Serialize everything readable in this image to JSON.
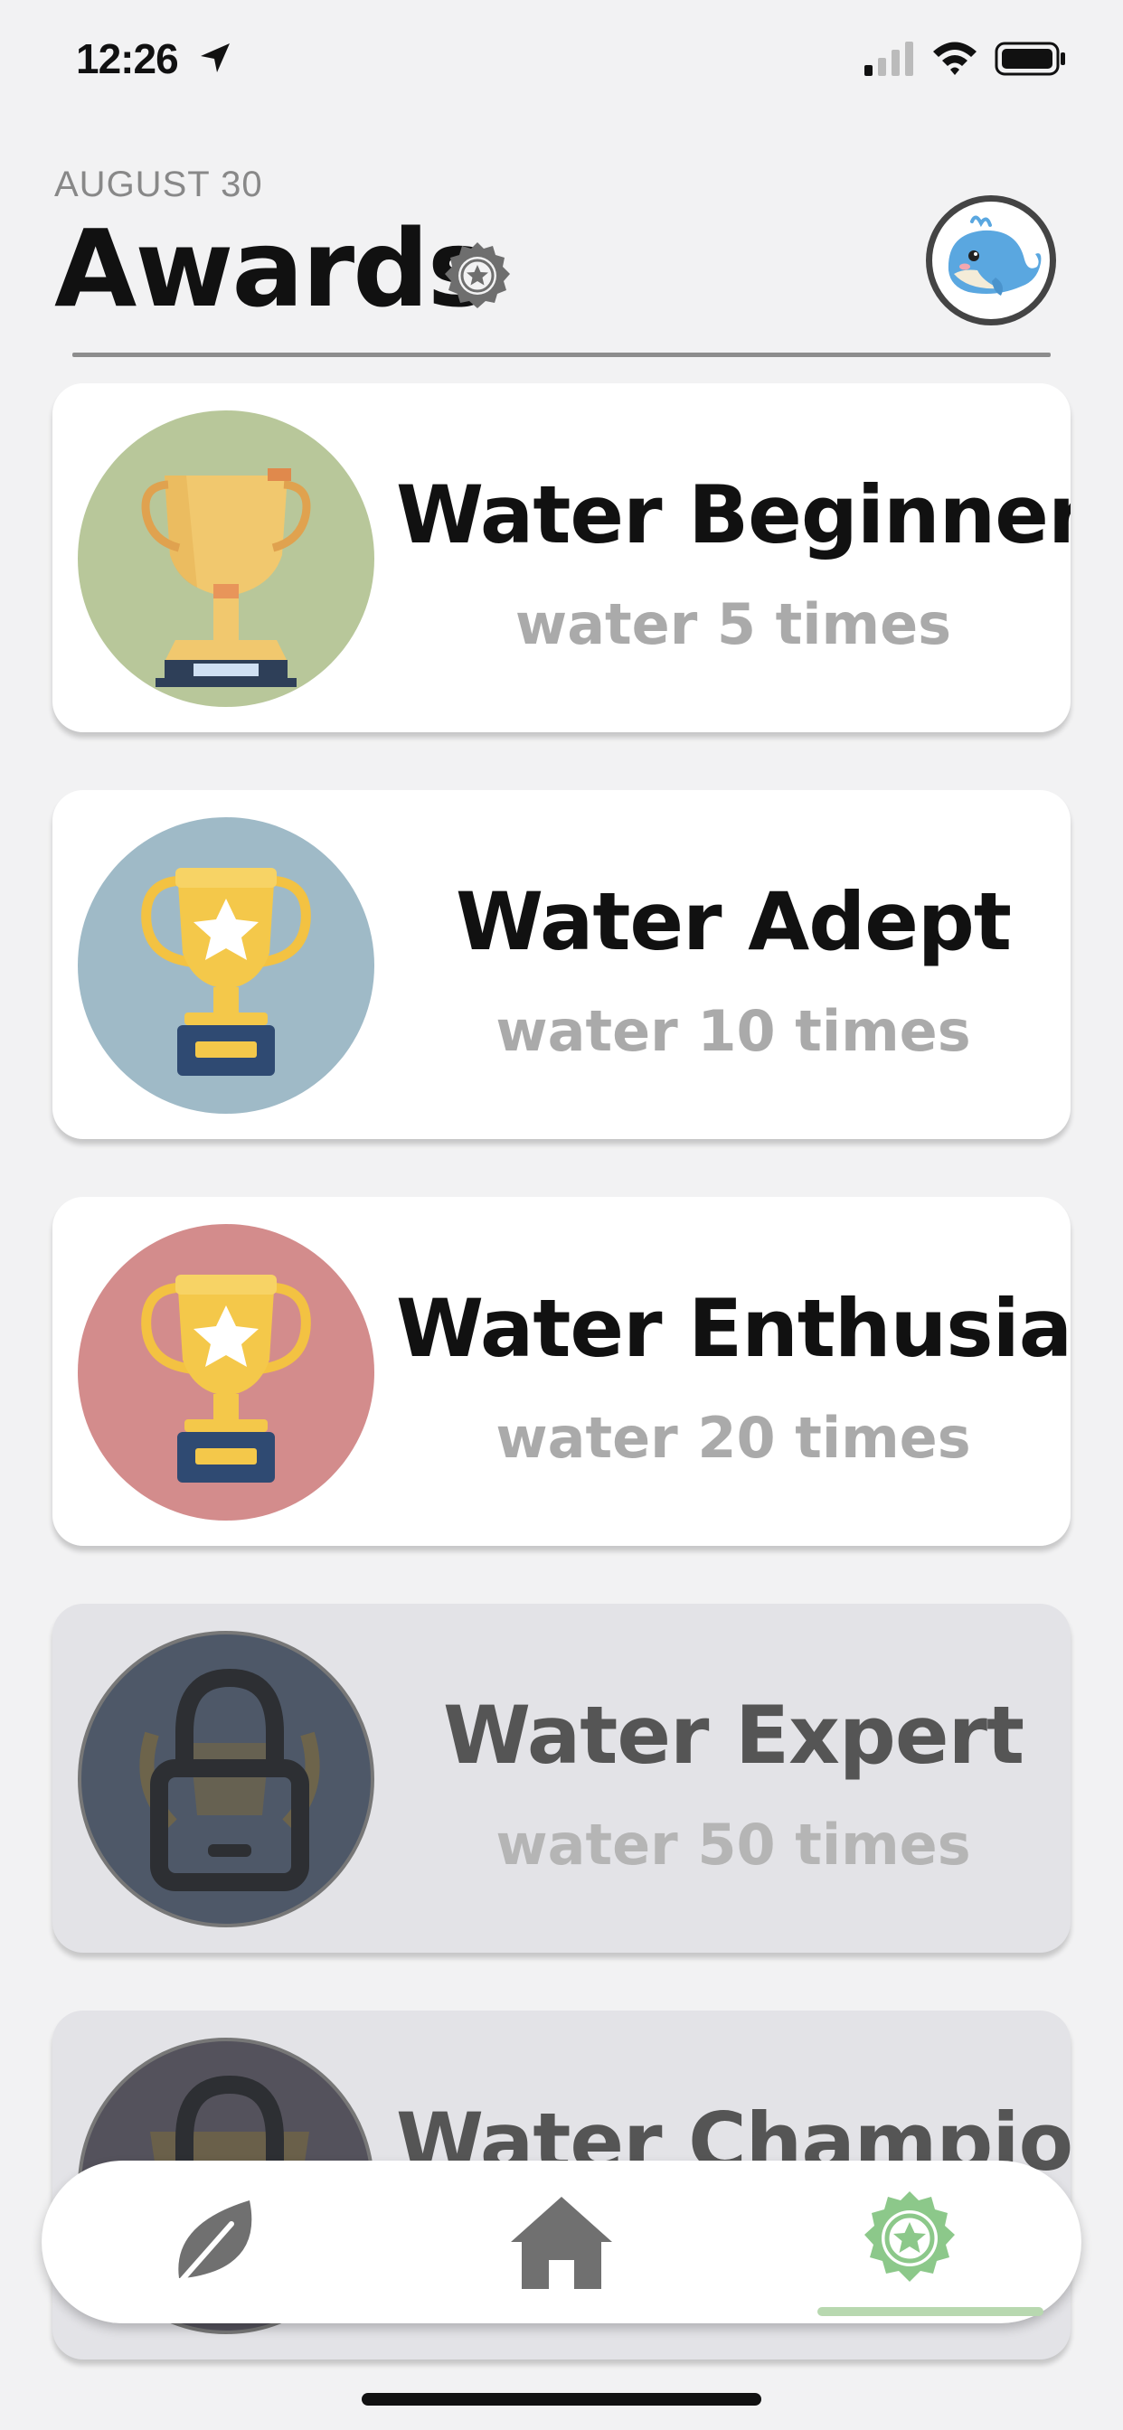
{
  "status_bar": {
    "time": "12:26"
  },
  "header": {
    "date": "AUGUST 30",
    "title": "Awards"
  },
  "awards": [
    {
      "title": "Water Beginner",
      "subtitle": "water 5 times",
      "locked": false,
      "icon": "trophy-icon"
    },
    {
      "title": "Water Adept",
      "subtitle": "water 10 times",
      "locked": false,
      "icon": "star-trophy-icon"
    },
    {
      "title": "Water Enthusiast",
      "subtitle": "water 20 times",
      "locked": false,
      "icon": "star-trophy-icon"
    },
    {
      "title": "Water Expert",
      "subtitle": "water 50 times",
      "locked": true,
      "icon": "lock-icon"
    },
    {
      "title": "Water Champion",
      "subtitle": "",
      "locked": true,
      "icon": "lock-icon"
    }
  ],
  "tab_bar": {
    "tabs": [
      {
        "icon": "leaf-icon",
        "selected": false
      },
      {
        "icon": "home-icon",
        "selected": false
      },
      {
        "icon": "award-badge-icon",
        "selected": true
      }
    ]
  },
  "colors": {
    "accent_green": "#8cc88a",
    "beginner_bg": "#b8c79a",
    "adept_bg": "#9fbac7",
    "enthusiast_bg": "#d38c8c",
    "locked_bg": "#4e5868"
  }
}
